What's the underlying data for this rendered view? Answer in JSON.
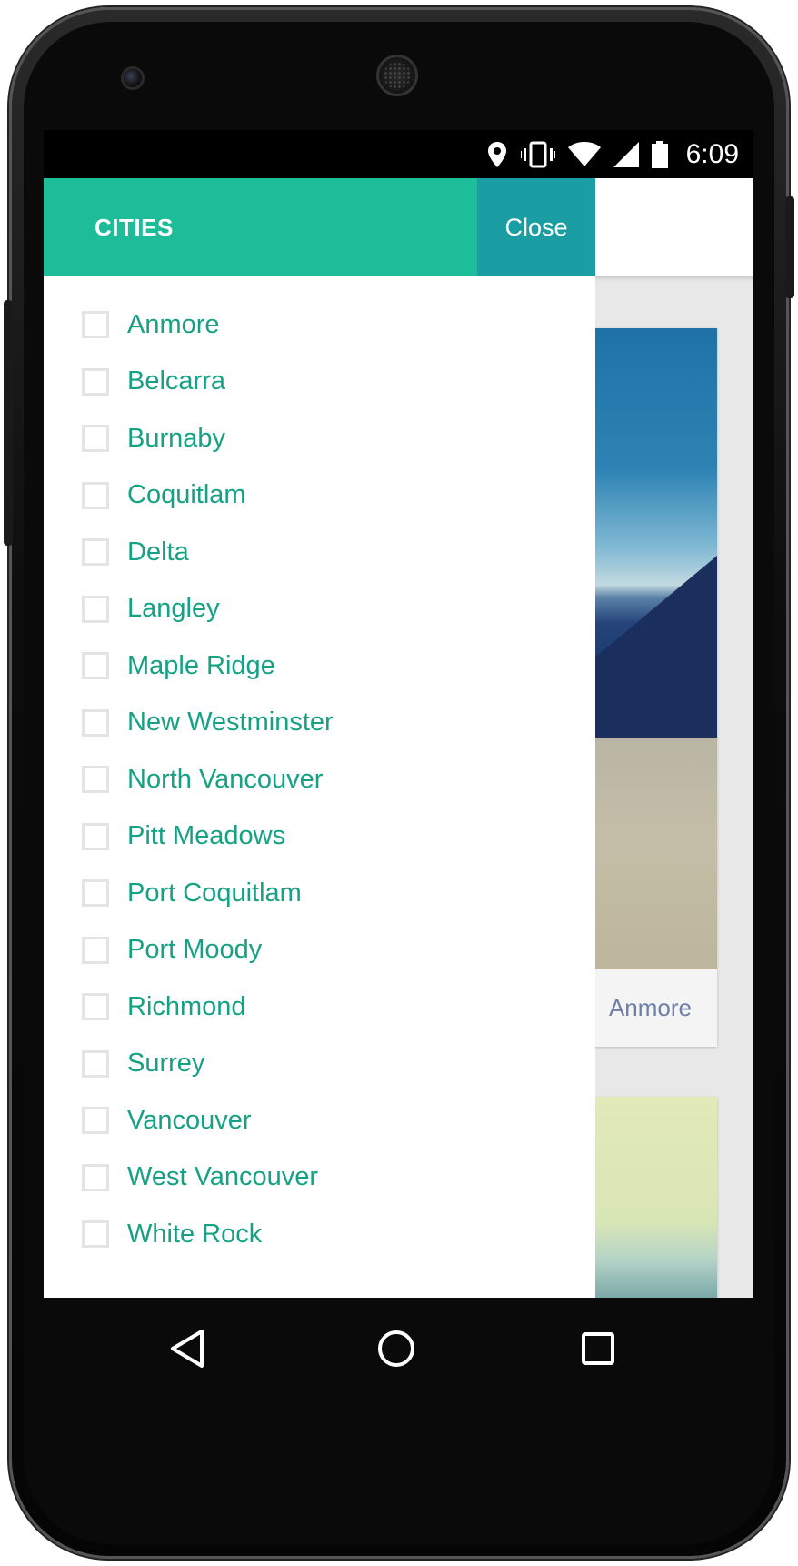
{
  "status_bar": {
    "time": "6:09",
    "icons": [
      "location-icon",
      "vibrate-icon",
      "wifi-icon",
      "signal-icon",
      "battery-icon"
    ]
  },
  "drawer": {
    "title": "CITIES",
    "close_label": "Close",
    "header_color": "#1dbd9a",
    "close_color": "#1a9ea4",
    "label_color": "#16a185",
    "cities": [
      "Anmore",
      "Belcarra",
      "Burnaby",
      "Coquitlam",
      "Delta",
      "Langley",
      "Maple Ridge",
      "New Westminster",
      "North Vancouver",
      "Pitt Meadows",
      "Port Coquitlam",
      "Port Moody",
      "Richmond",
      "Surrey",
      "Vancouver",
      "West Vancouver",
      "White Rock"
    ]
  },
  "background": {
    "card_caption": "Anmore"
  },
  "nav_bar": {
    "icons": [
      "back-icon",
      "home-icon",
      "recents-icon"
    ]
  }
}
